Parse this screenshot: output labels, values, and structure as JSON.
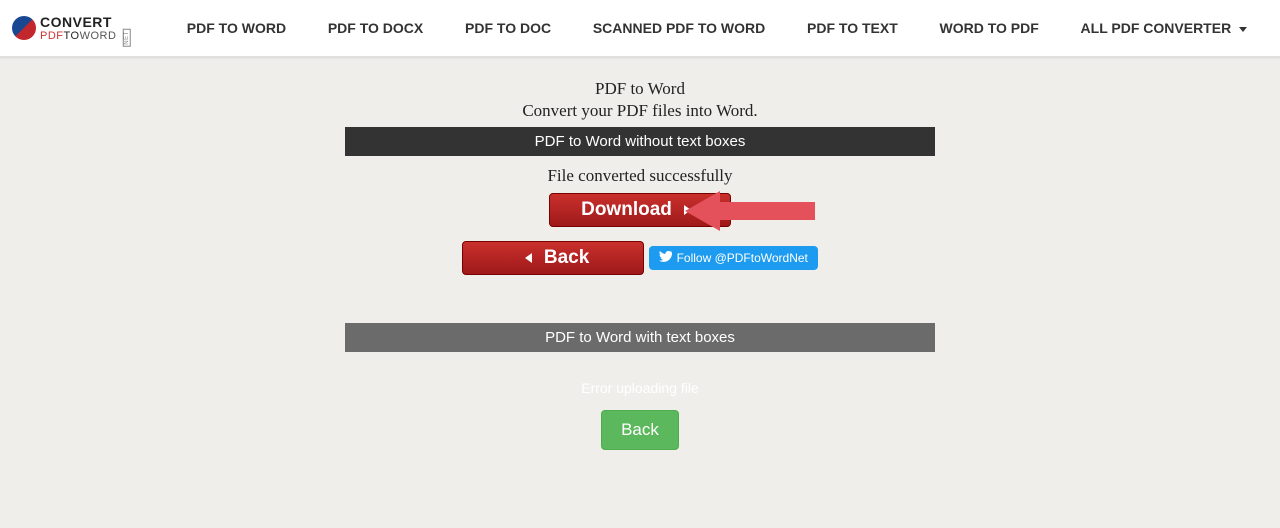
{
  "logo": {
    "top": "CONVERT",
    "sub_red": "PDF",
    "sub_blk": "TO",
    "sub_gry": "WORD",
    "badge": "NET"
  },
  "nav": {
    "items": [
      "PDF TO WORD",
      "PDF TO DOCX",
      "PDF TO DOC",
      "SCANNED PDF TO WORD",
      "PDF TO TEXT",
      "WORD TO PDF",
      "ALL PDF CONVERTER"
    ]
  },
  "page": {
    "title": "PDF to Word",
    "subtitle": "Convert your PDF files into Word."
  },
  "section1": {
    "heading": "PDF to Word without text boxes",
    "status": "File converted successfully",
    "download_label": "Download",
    "back_label": "Back"
  },
  "twitter": {
    "label": "Follow @PDFtoWordNet"
  },
  "section2": {
    "heading": "PDF to Word with text boxes",
    "error": "Error uploading file",
    "back_label": "Back"
  }
}
